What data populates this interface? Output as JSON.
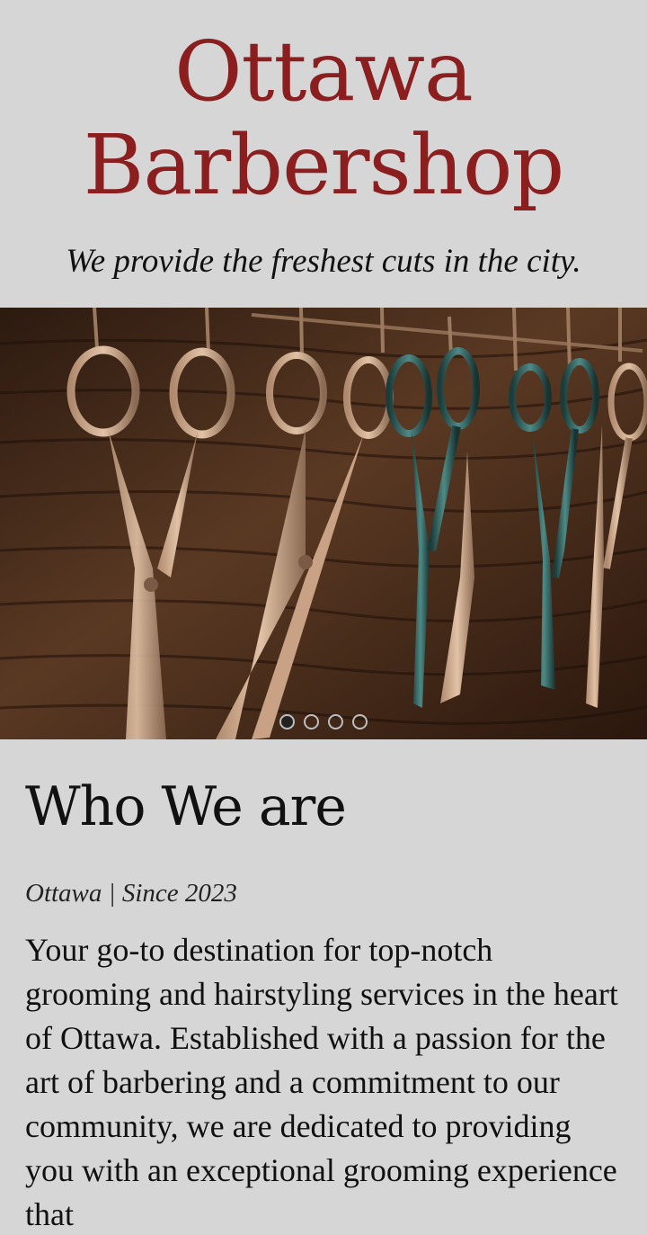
{
  "header": {
    "title_line1": "Ottawa",
    "title_line2": "Barbershop",
    "tagline": "We provide the freshest cuts in the city."
  },
  "carousel": {
    "slide_count": 4,
    "active_index": 0,
    "image_icon": "scissors-on-wood-photo"
  },
  "about": {
    "title": "Who We are",
    "subtitle": "Ottawa | Since 2023",
    "body": "Your go-to destination for top-notch grooming and hairstyling services in the heart of Ottawa. Established with a passion for the art of barbering and a commitment to our community, we are dedicated to providing you with an exceptional grooming experience that"
  },
  "colors": {
    "background": "#d6d6d6",
    "title_red": "#8b1e1f",
    "text": "#111111"
  }
}
